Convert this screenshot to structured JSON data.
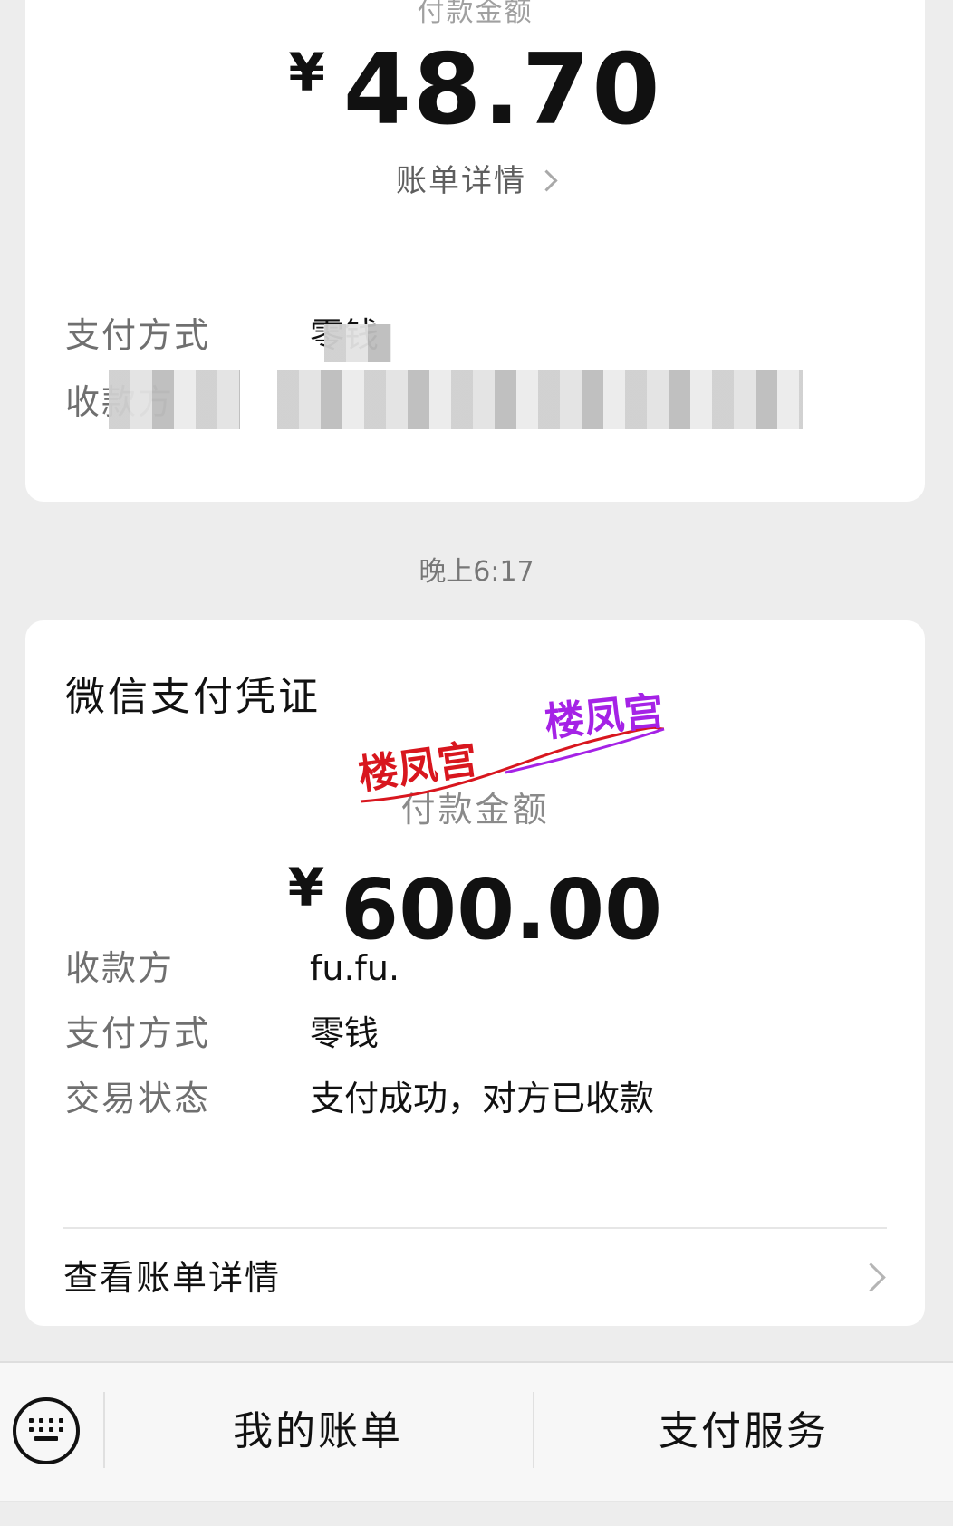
{
  "previous_receipt": {
    "label_partial": "付款金额",
    "currency_symbol": "¥",
    "amount": "48.70",
    "bill_detail_label": "账单详情",
    "rows": [
      {
        "key": "支付方式",
        "value": "零钱"
      },
      {
        "key": "收款方",
        "value": ""
      }
    ]
  },
  "timestamp": "晚上6:17",
  "voucher": {
    "title": "微信支付凭证",
    "watermark": "楼凤宫",
    "amount_label": "付款金额",
    "currency_symbol": "¥",
    "amount": "600.00",
    "rows": [
      {
        "key": "收款方",
        "value": "fu.fu."
      },
      {
        "key": "支付方式",
        "value": "零钱"
      },
      {
        "key": "交易状态",
        "value": "支付成功，对方已收款"
      }
    ],
    "view_detail_label": "查看账单详情"
  },
  "bottom_bar": {
    "keyboard_icon": "keyboard-icon",
    "tabs": [
      {
        "label": "我的账单"
      },
      {
        "label": "支付服务"
      }
    ]
  },
  "colors": {
    "background": "#ededed",
    "card": "#ffffff",
    "watermark_red": "#d8161e",
    "watermark_purple": "#a522e6"
  }
}
